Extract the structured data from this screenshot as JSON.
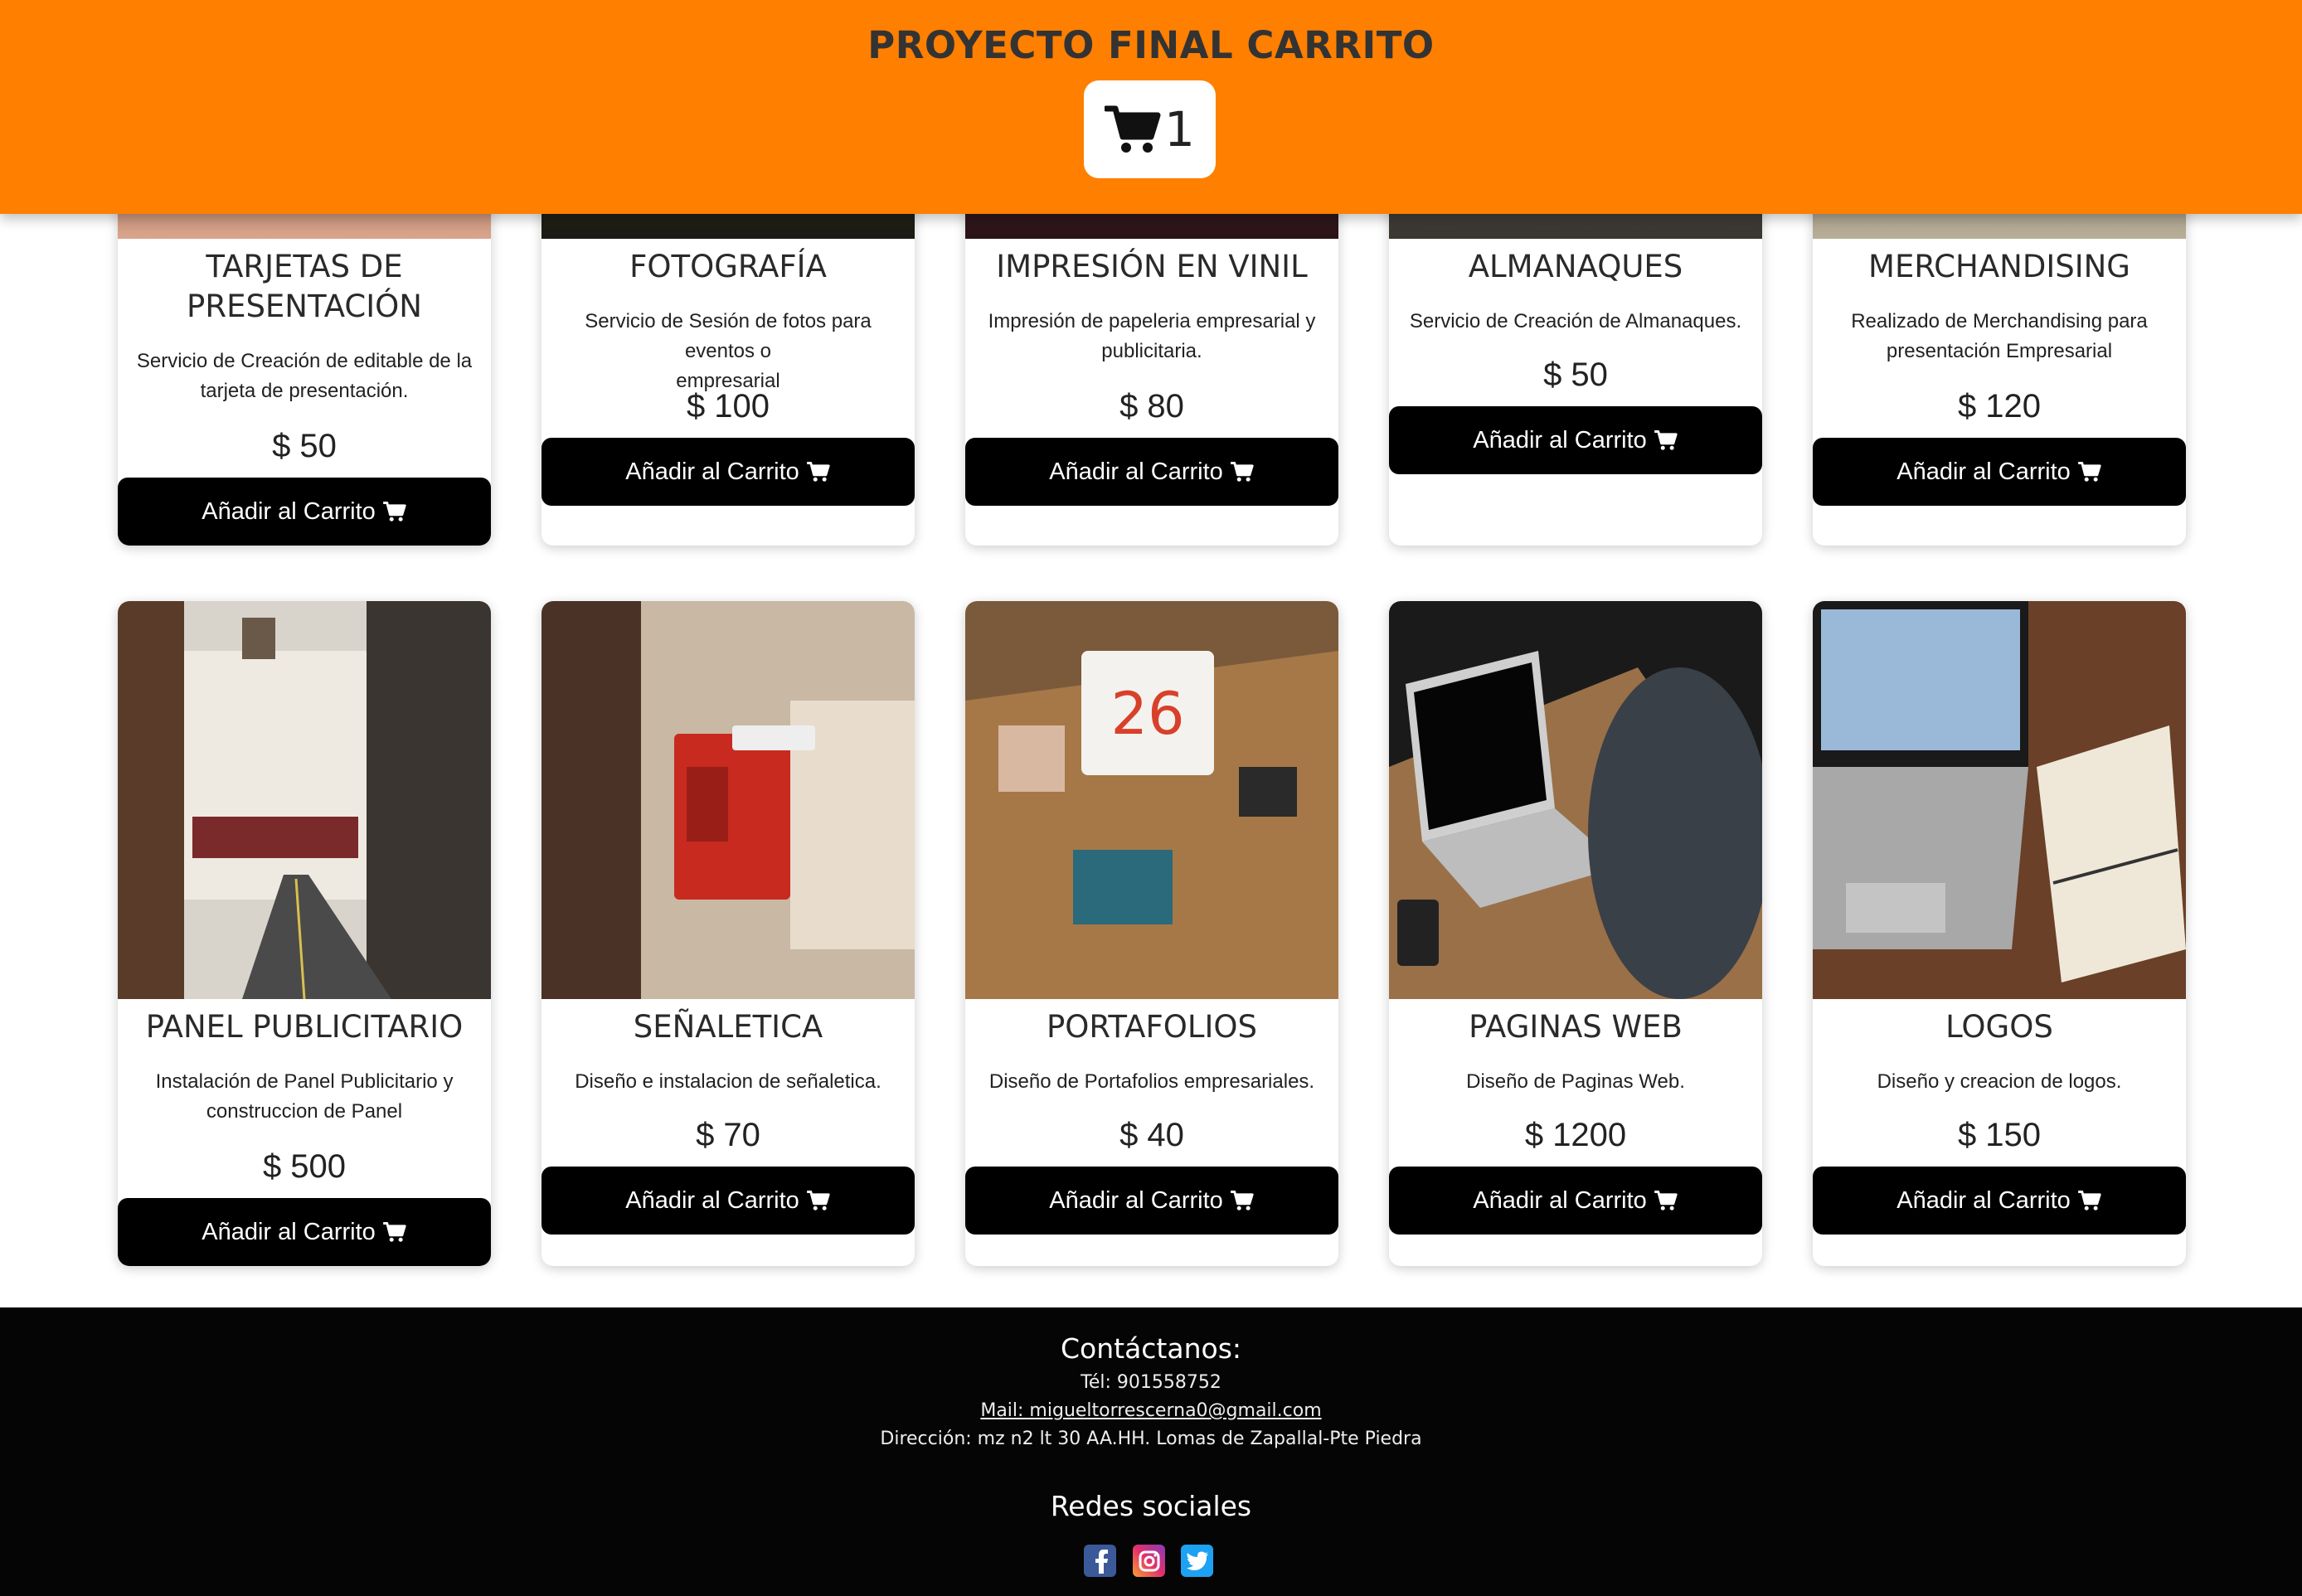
{
  "header": {
    "title": "PROYECTO FINAL CARRITO",
    "cart_count": "1",
    "cart_icon": "shopping-cart-icon",
    "bg_color": "#ff7f00"
  },
  "products_row1": [
    {
      "title_line1": "TARJETAS DE",
      "title_line2": "PRESENTACIÓN",
      "desc_line1": "Servicio de Creación de editable de la",
      "desc_line2": "tarjeta de presentación.",
      "price": "$ 50",
      "button": "Añadir al Carrito"
    },
    {
      "title_line1": "FOTOGRAFÍA",
      "desc_line1": "Servicio de Sesión de fotos para eventos o",
      "desc_line2": "empresarial",
      "price": "$ 100",
      "button": "Añadir al Carrito"
    },
    {
      "title_line1": "IMPRESIÓN EN VINIL",
      "desc_line1": "Impresión de papeleria empresarial y",
      "desc_line2": "publicitaria.",
      "price": "$ 80",
      "button": "Añadir al Carrito"
    },
    {
      "title_line1": "ALMANAQUES",
      "desc_line1": "Servicio de Creación de Almanaques.",
      "price": "$ 50",
      "button": "Añadir al Carrito"
    },
    {
      "title_line1": "MERCHANDISING",
      "desc_line1": "Realizado de Merchandising para",
      "desc_line2": "presentación Empresarial",
      "price": "$ 120",
      "button": "Añadir al Carrito"
    }
  ],
  "products_row2": [
    {
      "title": "PANEL PUBLICITARIO",
      "desc_line1": "Instalación de Panel Publicitario y",
      "desc_line2": "construccion de Panel",
      "price": "$ 500",
      "button": "Añadir al Carrito"
    },
    {
      "title": "SEÑALETICA",
      "desc_line1": "Diseño e instalacion de señaletica.",
      "price": "$ 70",
      "button": "Añadir al Carrito"
    },
    {
      "title": "PORTAFOLIOS",
      "desc_line1": "Diseño de Portafolios empresariales.",
      "price": "$ 40",
      "button": "Añadir al Carrito"
    },
    {
      "title": "PAGINAS WEB",
      "desc_line1": "Diseño de Paginas Web.",
      "price": "$ 1200",
      "button": "Añadir al Carrito"
    },
    {
      "title": "LOGOS",
      "desc_line1": "Diseño y creacion de logos.",
      "price": "$ 150",
      "button": "Añadir al Carrito"
    }
  ],
  "footer": {
    "contact_title": "Contáctanos:",
    "phone": "Tél: 901558752",
    "mail": "Mail: migueltorrescerna0@gmail.com",
    "address": "Dirección: mz n2 lt 30 AA.HH. Lomas de Zapallal-Pte Piedra",
    "social_title": "Redes sociales",
    "social_icons": [
      "facebook-icon",
      "instagram-icon",
      "twitter-icon"
    ]
  }
}
